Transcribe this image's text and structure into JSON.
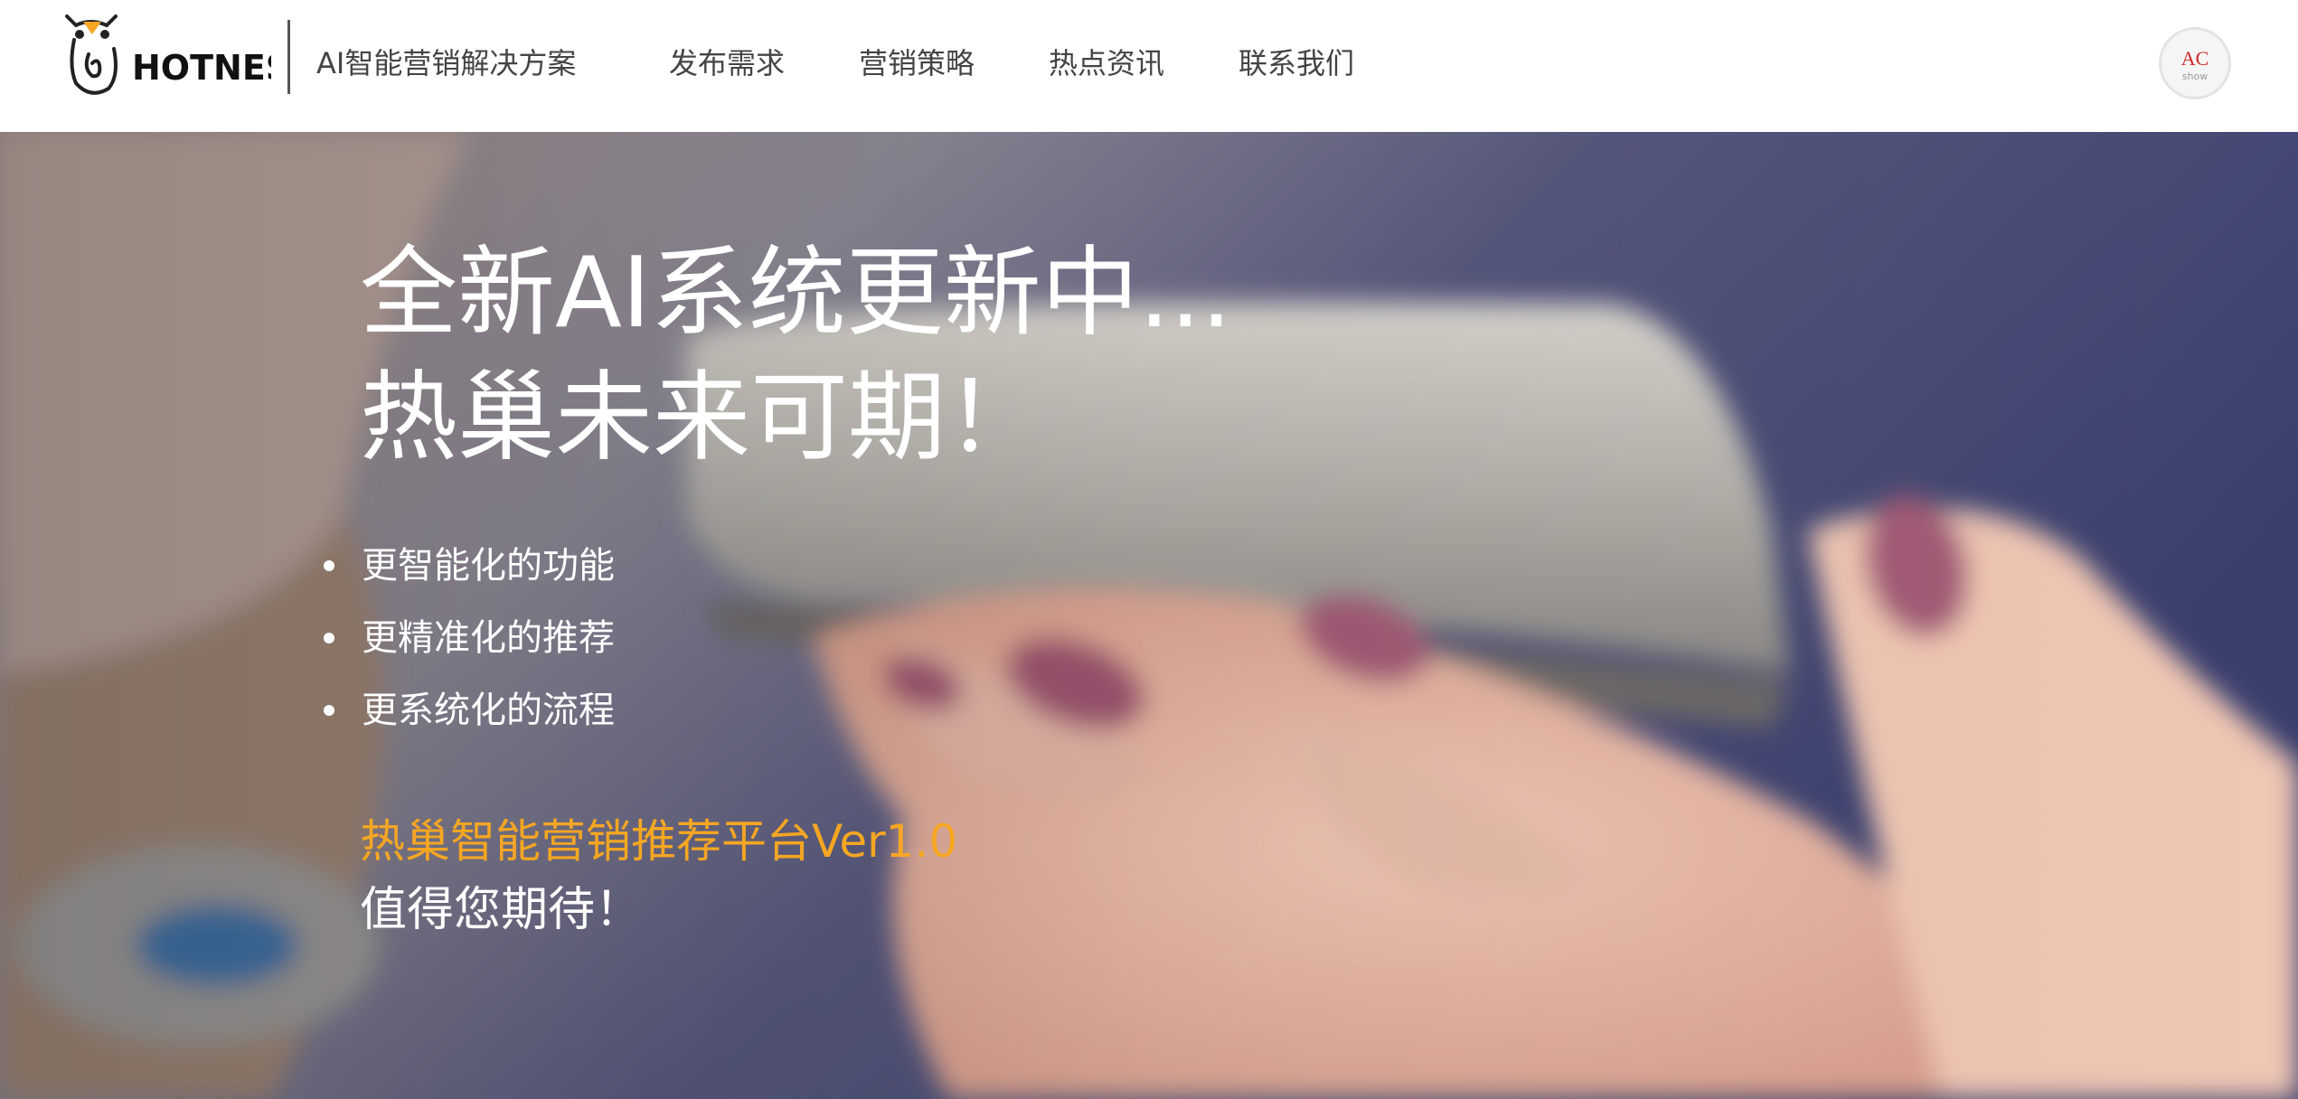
{
  "brand": {
    "logo_text": "HOTNEST",
    "tagline": "AI智能营销解决方案"
  },
  "nav": {
    "items": [
      {
        "label": "发布需求"
      },
      {
        "label": "营销策略"
      },
      {
        "label": "热点资讯"
      },
      {
        "label": "联系我们"
      }
    ]
  },
  "avatar": {
    "line1": "AC",
    "line2": "show"
  },
  "hero": {
    "title_line1": "全新AI系统更新中...",
    "title_line2": "热巢未来可期！",
    "features": [
      "更智能化的功能",
      "更精准化的推荐",
      "更系统化的流程"
    ],
    "platform": "热巢智能营销推荐平台Ver1.0",
    "await": "值得您期待！"
  },
  "colors": {
    "accent": "#f5a623",
    "text_dark": "#444444",
    "hero_text": "#ffffff"
  }
}
